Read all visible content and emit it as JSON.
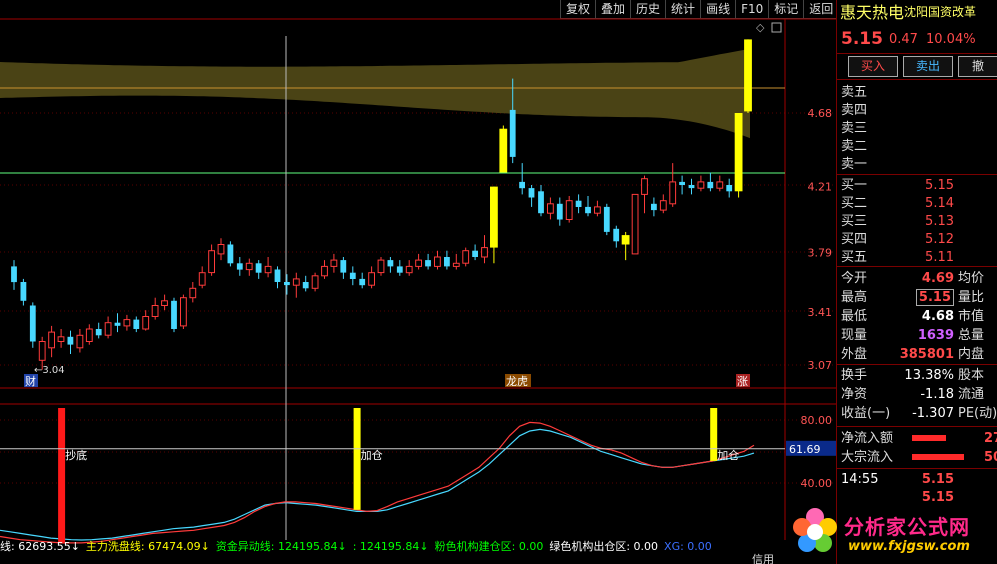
{
  "toolbar": {
    "items": [
      "复权",
      "叠加",
      "历史",
      "统计",
      "画线",
      "F10",
      "标记",
      "返回"
    ]
  },
  "stock": {
    "name": "惠天热电",
    "sector": "沈阳国资改革",
    "price": "5.15",
    "change": "0.47",
    "change_pct": "10.04%"
  },
  "trade_buttons": {
    "buy": "买入",
    "sell": "卖出",
    "cancel": "撤"
  },
  "sell_book": [
    "卖五",
    "卖四",
    "卖三",
    "卖二",
    "卖一"
  ],
  "buy_book": [
    {
      "label": "买一",
      "price": "5.15"
    },
    {
      "label": "买二",
      "price": "5.14"
    },
    {
      "label": "买三",
      "price": "5.13"
    },
    {
      "label": "买四",
      "price": "5.12"
    },
    {
      "label": "买五",
      "price": "5.11"
    }
  ],
  "quote": [
    {
      "l1": "今开",
      "v1": "4.69",
      "l2": "均价",
      "c": "red"
    },
    {
      "l1": "最高",
      "v1": "5.15",
      "l2": "量比",
      "c": "red",
      "boxed": true
    },
    {
      "l1": "最低",
      "v1": "4.68",
      "l2": "市值",
      "c": "white"
    },
    {
      "l1": "现量",
      "v1": "1639",
      "l2": "总量",
      "c": "purple"
    },
    {
      "l1": "外盘",
      "v1": "385801",
      "l2": "内盘",
      "c": "red"
    }
  ],
  "stats": [
    {
      "l1": "换手",
      "v1": "13.38%",
      "l2": "股本"
    },
    {
      "l1": "净资",
      "v1": "-1.18",
      "l2": "流通"
    },
    {
      "l1": "收益(一)",
      "v1": "-1.307",
      "l2": "PE(动)"
    }
  ],
  "flows": [
    {
      "label": "净流入额",
      "value": "27"
    },
    {
      "label": "大宗流入",
      "value": "50"
    }
  ],
  "ticks": [
    {
      "time": "14:55",
      "price": "5.15"
    },
    {
      "time": "",
      "price": "5.15"
    }
  ],
  "price_axis": [
    "4.68",
    "4.21",
    "3.79",
    "3.41",
    "3.07"
  ],
  "ind_axis": [
    "80.00",
    "60.00",
    "40.00"
  ],
  "ind_marker": "61.69",
  "annotations": {
    "low_label": "3.04",
    "cai": "财",
    "longhu": "龙虎",
    "zhang": "涨",
    "chaodi": "抄底",
    "jiacang1": "加仓",
    "jiacang2": "加仓"
  },
  "bottom_bar": [
    {
      "text": "线: 62693.55↓",
      "color": "#ffffff"
    },
    {
      "text": "主力洗盘线: 67474.09↓",
      "color": "#ffff00"
    },
    {
      "text": "资金异动线: 124195.84↓",
      "color": "#00ff00"
    },
    {
      "text": ": 124195.84↓",
      "color": "#00ff00"
    },
    {
      "text": "粉色机构建仓区: 0.00",
      "color": "#00ff00"
    },
    {
      "text": "绿色机构出仓区: 0.00",
      "color": "#ffffff"
    },
    {
      "text": "XG: 0.00",
      "color": "#3b6fff"
    }
  ],
  "watermark": {
    "title": "分析家公式网",
    "url": "www.fxjgsw.com"
  },
  "corner_label": "信用",
  "colors": {
    "up": "#ff3b3b",
    "down": "#48d8ff",
    "signal": "#ffff00",
    "cloud": "#4e4716"
  },
  "chart_data": {
    "type": "candlestick",
    "y_axis_ticks": [
      4.68,
      4.21,
      3.79,
      3.41,
      3.07
    ],
    "low_marker": 3.04,
    "last_close": 5.15,
    "candles": [
      {
        "o": 3.7,
        "c": 3.6,
        "h": 3.74,
        "l": 3.55
      },
      {
        "o": 3.6,
        "c": 3.48,
        "h": 3.62,
        "l": 3.45
      },
      {
        "o": 3.45,
        "c": 3.22,
        "h": 3.47,
        "l": 3.18
      },
      {
        "o": 3.1,
        "c": 3.22,
        "h": 3.25,
        "l": 3.04
      },
      {
        "o": 3.18,
        "c": 3.28,
        "h": 3.32,
        "l": 3.12
      },
      {
        "o": 3.22,
        "c": 3.25,
        "h": 3.3,
        "l": 3.18
      },
      {
        "o": 3.25,
        "c": 3.2,
        "h": 3.29,
        "l": 3.14
      },
      {
        "o": 3.18,
        "c": 3.26,
        "h": 3.3,
        "l": 3.15
      },
      {
        "o": 3.22,
        "c": 3.3,
        "h": 3.33,
        "l": 3.2
      },
      {
        "o": 3.3,
        "c": 3.26,
        "h": 3.34,
        "l": 3.24
      },
      {
        "o": 3.26,
        "c": 3.34,
        "h": 3.38,
        "l": 3.24
      },
      {
        "o": 3.34,
        "c": 3.32,
        "h": 3.4,
        "l": 3.28
      },
      {
        "o": 3.32,
        "c": 3.36,
        "h": 3.39,
        "l": 3.29
      },
      {
        "o": 3.36,
        "c": 3.3,
        "h": 3.38,
        "l": 3.28
      },
      {
        "o": 3.3,
        "c": 3.38,
        "h": 3.42,
        "l": 3.29
      },
      {
        "o": 3.38,
        "c": 3.45,
        "h": 3.5,
        "l": 3.36
      },
      {
        "o": 3.45,
        "c": 3.48,
        "h": 3.52,
        "l": 3.42
      },
      {
        "o": 3.48,
        "c": 3.3,
        "h": 3.5,
        "l": 3.28
      },
      {
        "o": 3.32,
        "c": 3.5,
        "h": 3.52,
        "l": 3.3
      },
      {
        "o": 3.5,
        "c": 3.56,
        "h": 3.6,
        "l": 3.47
      },
      {
        "o": 3.58,
        "c": 3.66,
        "h": 3.7,
        "l": 3.56
      },
      {
        "o": 3.66,
        "c": 3.8,
        "h": 3.84,
        "l": 3.64
      },
      {
        "o": 3.78,
        "c": 3.84,
        "h": 3.88,
        "l": 3.74
      },
      {
        "o": 3.84,
        "c": 3.72,
        "h": 3.86,
        "l": 3.7
      },
      {
        "o": 3.72,
        "c": 3.68,
        "h": 3.76,
        "l": 3.64
      },
      {
        "o": 3.68,
        "c": 3.72,
        "h": 3.75,
        "l": 3.64
      },
      {
        "o": 3.72,
        "c": 3.66,
        "h": 3.74,
        "l": 3.62
      },
      {
        "o": 3.66,
        "c": 3.7,
        "h": 3.76,
        "l": 3.63
      },
      {
        "o": 3.68,
        "c": 3.6,
        "h": 3.7,
        "l": 3.56
      },
      {
        "o": 3.6,
        "c": 3.58,
        "h": 3.65,
        "l": 3.52
      },
      {
        "o": 3.58,
        "c": 3.62,
        "h": 3.66,
        "l": 3.5
      },
      {
        "o": 3.6,
        "c": 3.56,
        "h": 3.64,
        "l": 3.54
      },
      {
        "o": 3.56,
        "c": 3.64,
        "h": 3.66,
        "l": 3.54
      },
      {
        "o": 3.64,
        "c": 3.7,
        "h": 3.74,
        "l": 3.62
      },
      {
        "o": 3.7,
        "c": 3.74,
        "h": 3.78,
        "l": 3.66
      },
      {
        "o": 3.74,
        "c": 3.66,
        "h": 3.76,
        "l": 3.62
      },
      {
        "o": 3.66,
        "c": 3.62,
        "h": 3.7,
        "l": 3.58
      },
      {
        "o": 3.62,
        "c": 3.58,
        "h": 3.66,
        "l": 3.56
      },
      {
        "o": 3.58,
        "c": 3.66,
        "h": 3.7,
        "l": 3.56
      },
      {
        "o": 3.66,
        "c": 3.74,
        "h": 3.76,
        "l": 3.64
      },
      {
        "o": 3.74,
        "c": 3.7,
        "h": 3.76,
        "l": 3.66
      },
      {
        "o": 3.7,
        "c": 3.66,
        "h": 3.74,
        "l": 3.64
      },
      {
        "o": 3.66,
        "c": 3.7,
        "h": 3.74,
        "l": 3.64
      },
      {
        "o": 3.7,
        "c": 3.74,
        "h": 3.78,
        "l": 3.68
      },
      {
        "o": 3.74,
        "c": 3.7,
        "h": 3.78,
        "l": 3.68
      },
      {
        "o": 3.7,
        "c": 3.76,
        "h": 3.8,
        "l": 3.68
      },
      {
        "o": 3.76,
        "c": 3.7,
        "h": 3.8,
        "l": 3.68
      },
      {
        "o": 3.7,
        "c": 3.72,
        "h": 3.78,
        "l": 3.68
      },
      {
        "o": 3.72,
        "c": 3.8,
        "h": 3.82,
        "l": 3.7
      },
      {
        "o": 3.8,
        "c": 3.76,
        "h": 3.84,
        "l": 3.74
      },
      {
        "o": 3.76,
        "c": 3.82,
        "h": 3.9,
        "l": 3.72
      },
      {
        "o": 3.82,
        "c": 4.21,
        "h": 4.21,
        "l": 3.72
      },
      {
        "o": 4.3,
        "c": 4.58,
        "h": 4.6,
        "l": 4.3
      },
      {
        "o": 4.7,
        "c": 4.4,
        "h": 4.9,
        "l": 4.36
      },
      {
        "o": 4.24,
        "c": 4.2,
        "h": 4.36,
        "l": 4.16
      },
      {
        "o": 4.2,
        "c": 4.14,
        "h": 4.22,
        "l": 4.08
      },
      {
        "o": 4.18,
        "c": 4.04,
        "h": 4.22,
        "l": 4.02
      },
      {
        "o": 4.04,
        "c": 4.1,
        "h": 4.14,
        "l": 4.0
      },
      {
        "o": 4.1,
        "c": 4.0,
        "h": 4.14,
        "l": 3.96
      },
      {
        "o": 4.0,
        "c": 4.12,
        "h": 4.15,
        "l": 3.98
      },
      {
        "o": 4.12,
        "c": 4.08,
        "h": 4.16,
        "l": 4.04
      },
      {
        "o": 4.08,
        "c": 4.04,
        "h": 4.15,
        "l": 4.02
      },
      {
        "o": 4.04,
        "c": 4.08,
        "h": 4.12,
        "l": 4.02
      },
      {
        "o": 4.08,
        "c": 3.92,
        "h": 4.1,
        "l": 3.9
      },
      {
        "o": 3.94,
        "c": 3.86,
        "h": 3.96,
        "l": 3.82
      },
      {
        "o": 3.84,
        "c": 3.9,
        "h": 3.92,
        "l": 3.74
      },
      {
        "o": 3.78,
        "c": 4.16,
        "h": 4.16,
        "l": 3.78
      },
      {
        "o": 4.16,
        "c": 4.26,
        "h": 4.28,
        "l": 4.04
      },
      {
        "o": 4.1,
        "c": 4.06,
        "h": 4.14,
        "l": 4.02
      },
      {
        "o": 4.06,
        "c": 4.12,
        "h": 4.16,
        "l": 4.04
      },
      {
        "o": 4.1,
        "c": 4.24,
        "h": 4.36,
        "l": 4.08
      },
      {
        "o": 4.24,
        "c": 4.22,
        "h": 4.28,
        "l": 4.16
      },
      {
        "o": 4.22,
        "c": 4.2,
        "h": 4.26,
        "l": 4.16
      },
      {
        "o": 4.2,
        "c": 4.24,
        "h": 4.28,
        "l": 4.18
      },
      {
        "o": 4.24,
        "c": 4.2,
        "h": 4.3,
        "l": 4.18
      },
      {
        "o": 4.2,
        "c": 4.24,
        "h": 4.28,
        "l": 4.18
      },
      {
        "o": 4.22,
        "c": 4.18,
        "h": 4.26,
        "l": 4.14
      },
      {
        "o": 4.18,
        "c": 4.68,
        "h": 4.68,
        "l": 4.14
      },
      {
        "o": 4.69,
        "c": 5.15,
        "h": 5.15,
        "l": 4.68
      }
    ],
    "indicator": {
      "y_ticks": [
        80.0,
        60.0,
        40.0
      ],
      "marker": 61.69,
      "red_line": [
        6,
        5,
        4,
        3.5,
        3,
        2.5,
        2,
        2,
        2,
        2.5,
        3,
        4,
        5,
        6,
        7,
        8,
        8.5,
        9,
        9.5,
        10,
        11,
        12,
        13,
        15,
        18,
        22,
        25,
        27,
        28,
        28,
        27.5,
        27,
        26,
        25,
        24,
        23,
        22,
        22.5,
        25,
        28,
        30,
        32,
        34,
        36,
        38,
        42,
        46,
        50,
        56,
        62,
        70,
        76,
        78.5,
        78,
        76,
        73,
        70,
        67,
        64,
        62,
        61,
        59,
        56,
        53,
        51,
        50,
        50,
        51,
        52,
        53,
        54,
        56,
        58,
        60,
        64
      ],
      "cyan_line": [
        10,
        9,
        8,
        7,
        6,
        5,
        4.5,
        4,
        3.8,
        4,
        4.5,
        5,
        6,
        7,
        8,
        9,
        10,
        11,
        11.5,
        12,
        13,
        14,
        15,
        17,
        20,
        23,
        26,
        27,
        27.5,
        27,
        26.5,
        26,
        25,
        24,
        23,
        22,
        22,
        22,
        23,
        25,
        27,
        29,
        31,
        33,
        35,
        39,
        43,
        47,
        52,
        58,
        64,
        70,
        73,
        74,
        73,
        71,
        69,
        66,
        63,
        60,
        58,
        56,
        54,
        52,
        51,
        50,
        50,
        51,
        52,
        53,
        54,
        55,
        56,
        57,
        59
      ],
      "signals": [
        {
          "index": 6,
          "color": "red",
          "label": "抄底"
        },
        {
          "index": 35,
          "color": "yellow",
          "label": "加仓"
        },
        {
          "index": 70,
          "color": "yellow",
          "label": "加仓"
        }
      ]
    }
  }
}
